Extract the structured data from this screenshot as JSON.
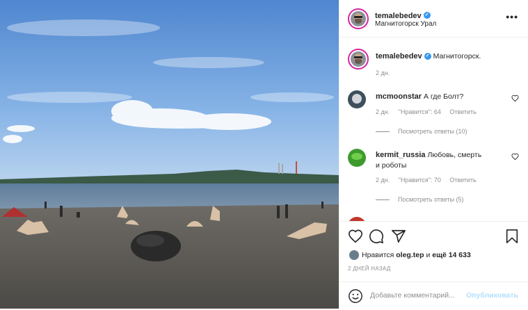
{
  "post": {
    "username": "temalebedev",
    "location": "Магнитогорск Урал",
    "more_label": "•••"
  },
  "caption": {
    "username": "temalebedev",
    "text": "Магнитогорск.",
    "time": "2 дн."
  },
  "comments": [
    {
      "username": "mcmoonstar",
      "text": "А где Болт?",
      "time": "2 дн.",
      "likes": "\"Нравится\": 64",
      "reply_label": "Ответить",
      "view_replies": "Посмотреть ответы (10)"
    },
    {
      "username": "kermit_russia",
      "text": "Любовь, смерть и роботы",
      "time": "2 дн.",
      "likes": "\"Нравится\": 70",
      "reply_label": "Ответить",
      "view_replies": "Посмотреть ответы (5)"
    }
  ],
  "likes": {
    "prefix": "Нравится",
    "user": "oleg.tep",
    "middle": "и",
    "count_text": "ещё 14 633"
  },
  "timestamp": "2 ДНЕЙ НАЗАД",
  "comment_box": {
    "placeholder": "Добавьте комментарий...",
    "publish_label": "Опубликовать"
  },
  "colors": {
    "verified": "#3897f0",
    "publish_disabled": "#b2dffc",
    "muted_text": "#8e8e8e",
    "story_ring": "#d6249f"
  },
  "icons": [
    "heart-icon",
    "comment-icon",
    "share-icon",
    "bookmark-icon",
    "emoji-icon",
    "verified-icon",
    "more-icon"
  ]
}
